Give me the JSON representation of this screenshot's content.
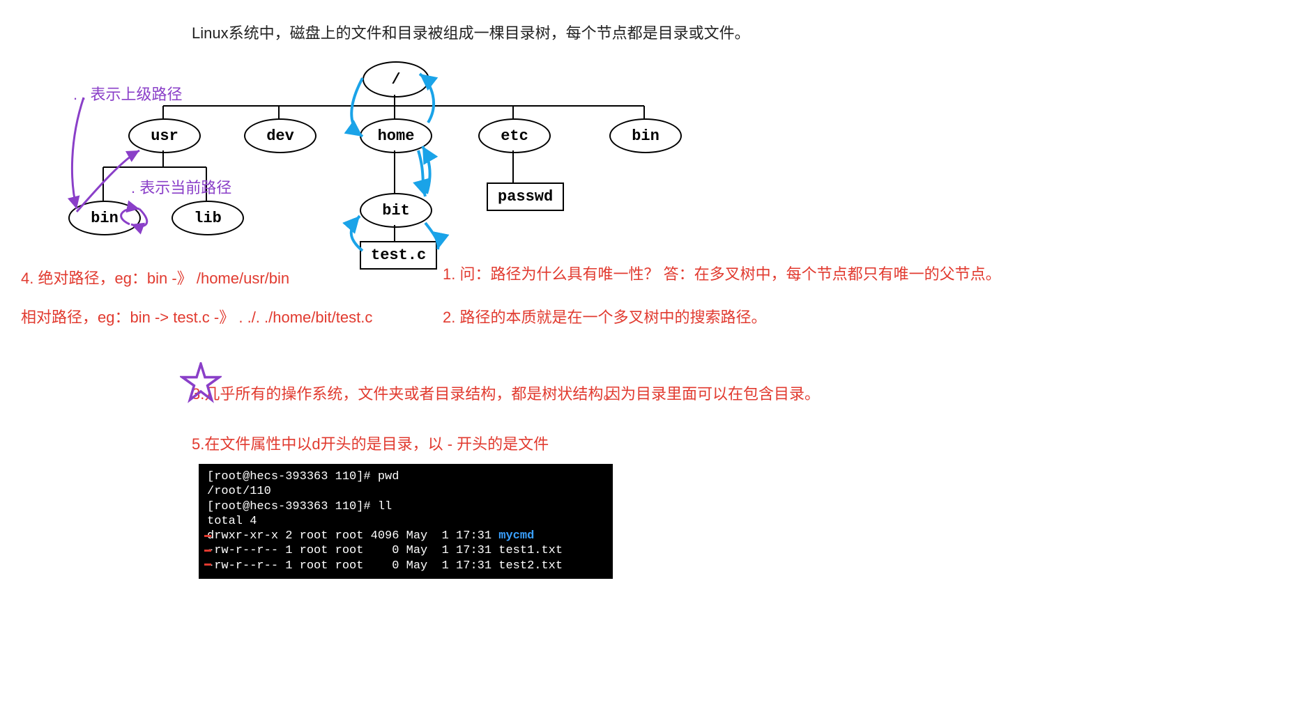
{
  "intro": "Linux系统中，磁盘上的文件和目录被组成一棵目录树，每个节点都是目录或文件。",
  "annotations": {
    "parent_path": ". . 表示上级路径",
    "current_path": ". 表示当前路径"
  },
  "notes": {
    "n4": "4. 绝对路径，eg：bin -》 /home/usr/bin",
    "n4b": "相对路径，eg：bin -> test.c  -》 . ./. ./home/bit/test.c",
    "n1": "1. 问：路径为什么具有唯一性？  答：在多叉树中，每个节点都只有唯一的父节点。",
    "n2": "2. 路径的本质就是在一个多叉树中的搜索路径。",
    "n3a": "3.几乎所有的操作系统，文件夹或者目录结构，都是树状结构。",
    "n3b": "因为目录里面可以在包含目录。",
    "n5": "5.在文件属性中以d开头的是目录，以 - 开头的是文件"
  },
  "tree": {
    "root": "/",
    "usr": "usr",
    "dev": "dev",
    "home": "home",
    "etc": "etc",
    "bin2": "bin",
    "bin": "bin",
    "lib": "lib",
    "bit": "bit",
    "passwd": "passwd",
    "testc": "test.c"
  },
  "terminal": {
    "prompt1": "[root@hecs-393363 110]# ",
    "cmd1": "pwd",
    "out1": "/root/110",
    "prompt2": "[root@hecs-393363 110]# ",
    "cmd2": "ll",
    "out2": "total 4",
    "l1a": "drwxr-xr-x 2 root root 4096 May  1 17:31 ",
    "l1b": "mycmd",
    "l2": "-rw-r--r-- 1 root root    0 May  1 17:31 test1.txt",
    "l3": "-rw-r--r-- 1 root root    0 May  1 17:31 test2.txt"
  }
}
